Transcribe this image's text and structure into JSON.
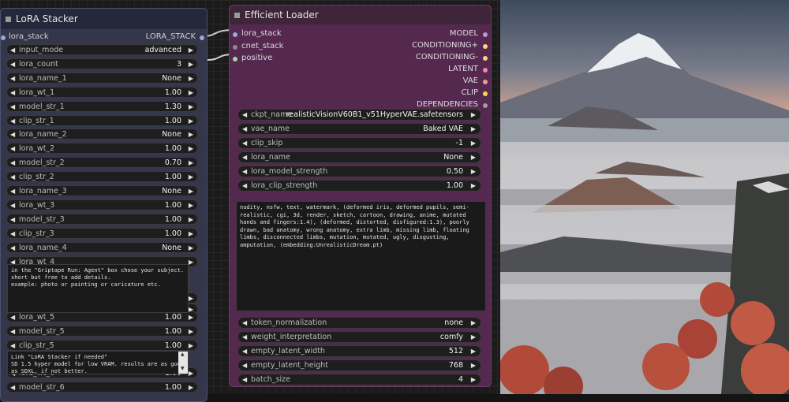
{
  "lora_stacker": {
    "title": "LoRA Stacker",
    "input_port": "lora_stack",
    "output_port": "LORA_STACK",
    "widgets": [
      {
        "label": "input_mode",
        "value": "advanced"
      },
      {
        "label": "lora_count",
        "value": "3"
      },
      {
        "label": "lora_name_1",
        "value": "None"
      },
      {
        "label": "lora_wt_1",
        "value": "1.00"
      },
      {
        "label": "model_str_1",
        "value": "1.30"
      },
      {
        "label": "clip_str_1",
        "value": "1.00"
      },
      {
        "label": "lora_name_2",
        "value": "None"
      },
      {
        "label": "lora_wt_2",
        "value": "1.00"
      },
      {
        "label": "model_str_2",
        "value": "0.70"
      },
      {
        "label": "clip_str_2",
        "value": "1.00"
      },
      {
        "label": "lora_name_3",
        "value": "None"
      },
      {
        "label": "lora_wt_3",
        "value": "1.00"
      },
      {
        "label": "model_str_3",
        "value": "1.00"
      },
      {
        "label": "clip_str_3",
        "value": "1.00"
      },
      {
        "label": "lora_name_4",
        "value": "None"
      },
      {
        "label": "lora_wt_4",
        "value": ""
      }
    ],
    "widgets_lower": [
      {
        "label": "lora_wt_5",
        "value": "1.00"
      },
      {
        "label": "model_str_5",
        "value": "1.00"
      },
      {
        "label": "clip_str_5",
        "value": "1.00"
      },
      {
        "label": "lora_wt_6",
        "value": "1.00"
      },
      {
        "label": "model_str_6",
        "value": "1.00"
      }
    ],
    "note_1": "in the \"Griptape Run: Agent\" box chose your subject.\nshort but free to add details.\nexample: photo or painting or caricature etc.",
    "note_2": "Link \"LoRA Stacker if needed\"\nSD 1.5 hyper model for low VRAM. results are as good\nas SDXL, if not better."
  },
  "efficient_loader": {
    "title": "Efficient Loader",
    "inputs": [
      "lora_stack",
      "cnet_stack",
      "positive"
    ],
    "outputs": [
      "MODEL",
      "CONDITIONING+",
      "CONDITIONING-",
      "LATENT",
      "VAE",
      "CLIP",
      "DEPENDENCIES"
    ],
    "widgets_top": [
      {
        "label": "ckpt_name",
        "value": "realisticVisionV60B1_v51HyperVAE.safetensors"
      },
      {
        "label": "vae_name",
        "value": "Baked VAE"
      },
      {
        "label": "clip_skip",
        "value": "-1"
      },
      {
        "label": "lora_name",
        "value": "None"
      },
      {
        "label": "lora_model_strength",
        "value": "0.50"
      },
      {
        "label": "lora_clip_strength",
        "value": "1.00"
      }
    ],
    "negative_prompt": "nudity, nsfw, text, watermark, (deformed iris, deformed pupils, semi-realistic, cgi, 3d, render, sketch, cartoon, drawing, anime, mutated hands and fingers:1.4), (deformed, distorted, disfigured:1.3), poorly drawn, bad anatomy, wrong anatomy, extra limb, missing limb, floating limbs, disconnected limbs, mutation, mutated, ugly, disgusting, amputation, (embedding:UnrealisticDream.pt)",
    "widgets_bottom": [
      {
        "label": "token_normalization",
        "value": "none"
      },
      {
        "label": "weight_interpretation",
        "value": "comfy"
      },
      {
        "label": "empty_latent_width",
        "value": "512"
      },
      {
        "label": "empty_latent_height",
        "value": "768"
      },
      {
        "label": "batch_size",
        "value": "4"
      }
    ]
  },
  "colors": {
    "model": "#b39ddb",
    "conditioning": "#ffd180",
    "latent": "#ff80ab",
    "vae": "#ef9a9a",
    "clip": "#ffd54f",
    "dependencies": "#9e9e9e",
    "lora_stack": "#9fa8da",
    "positive": "#a5d6a7"
  }
}
